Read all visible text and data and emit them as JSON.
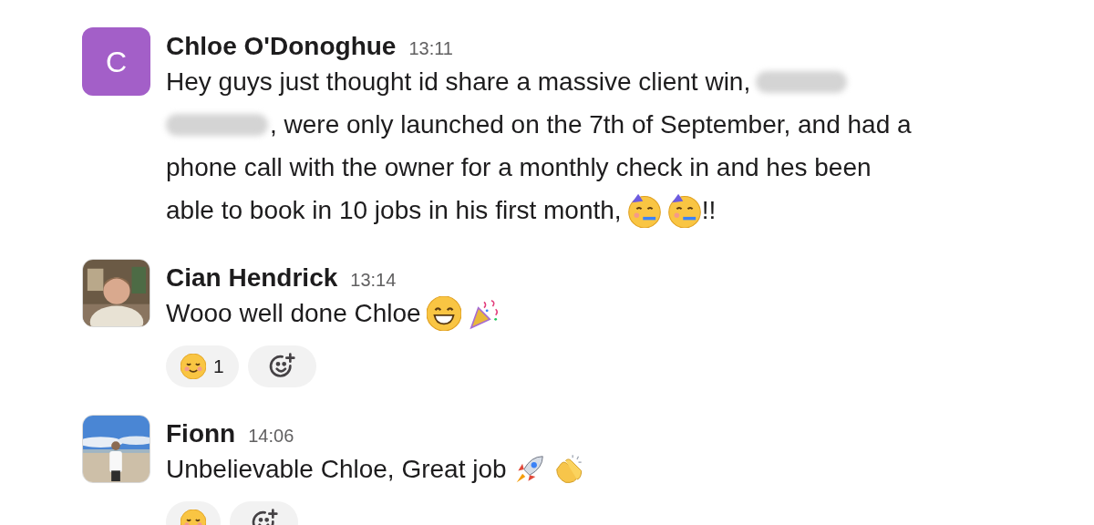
{
  "messages": [
    {
      "author": "Chloe O'Donoghue",
      "time": "13:11",
      "avatar": {
        "kind": "letter",
        "letter": "C",
        "color": "#a35fc8"
      },
      "lines": [
        [
          {
            "kind": "text",
            "text": "Hey guys just thought id share a massive client win,"
          },
          {
            "kind": "redacted"
          }
        ],
        [
          {
            "kind": "redacted"
          },
          {
            "kind": "text",
            "text": ", were only launched on the 7th of September, and had a"
          }
        ],
        [
          {
            "kind": "text",
            "text": "phone call with the owner for a monthly check in and hes been"
          }
        ],
        [
          {
            "kind": "text",
            "text": "able to book in 10 jobs in his first month,"
          },
          {
            "kind": "partying"
          },
          {
            "kind": "partying"
          },
          {
            "kind": "text",
            "text": "!!"
          }
        ]
      ]
    },
    {
      "author": "Cian Hendrick",
      "time": "13:14",
      "avatar": {
        "kind": "indoor"
      },
      "lines": [
        [
          {
            "kind": "text",
            "text": "Wooo well done Chloe"
          },
          {
            "kind": "grin"
          },
          {
            "kind": "popper"
          }
        ]
      ],
      "reactions": [
        {
          "kind": "smiling",
          "count": "1"
        }
      ],
      "add_reaction": true
    },
    {
      "author": "Fionn",
      "time": "14:06",
      "avatar": {
        "kind": "beach"
      },
      "lines": [
        [
          {
            "kind": "text",
            "text": "Unbelievable Chloe, Great job"
          },
          {
            "kind": "rocket"
          },
          {
            "kind": "clap"
          }
        ]
      ],
      "reactions": [
        {
          "kind": "smiling"
        }
      ],
      "add_reaction": true
    }
  ]
}
